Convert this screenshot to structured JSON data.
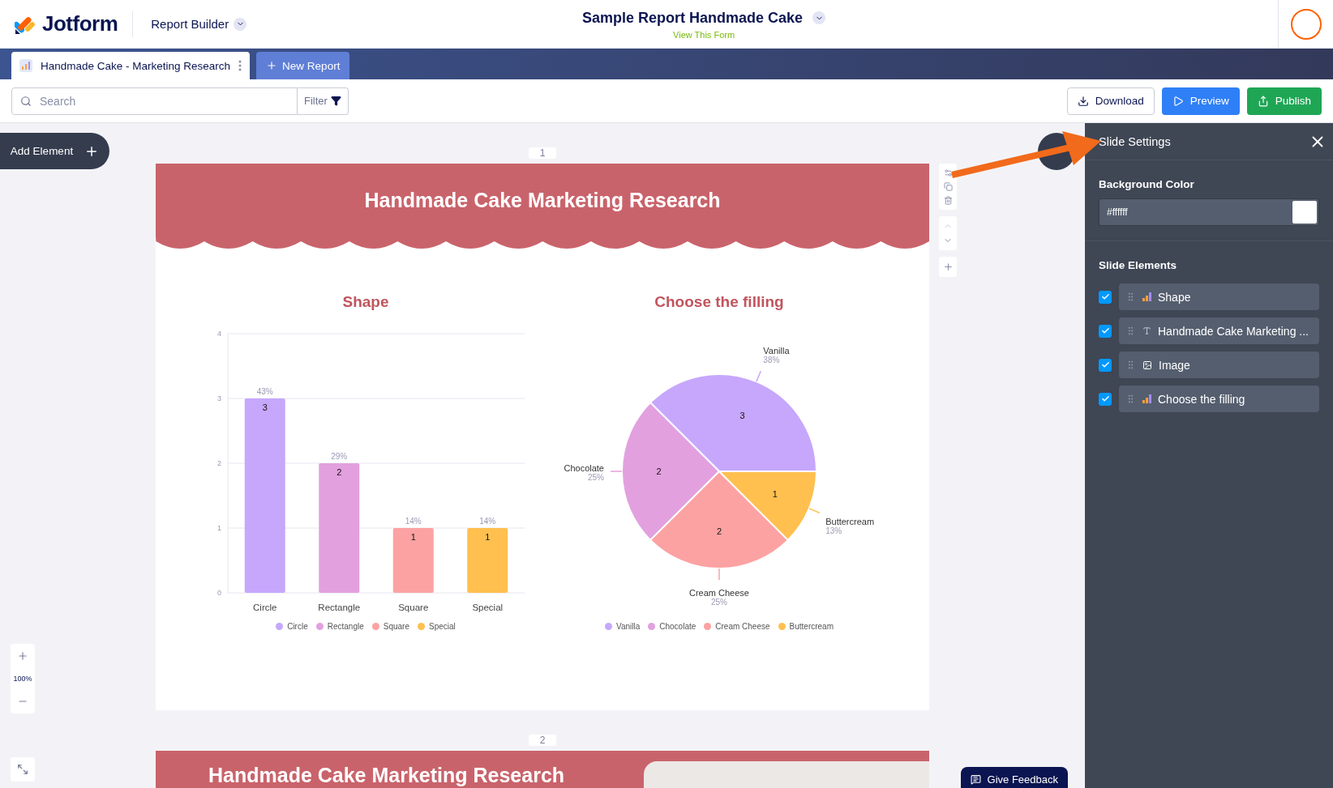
{
  "header": {
    "logo": "Jotform",
    "app_menu": "Report Builder",
    "form_title": "Sample Report Handmade Cake",
    "form_link": "View This Form"
  },
  "tabs": [
    {
      "label": "Handmade Cake - Marketing Research",
      "selected": true
    }
  ],
  "new_report": "New Report",
  "toolbar": {
    "search": {
      "placeholder": "Search"
    },
    "filter": "Filter",
    "buttons": [
      {
        "label": "Download",
        "kind": "outline"
      },
      {
        "label": "Preview",
        "kind": "blue"
      },
      {
        "label": "Publish",
        "kind": "green"
      }
    ]
  },
  "canvas": {
    "add_element": "Add Element",
    "zoom": "100%",
    "feedback": "Give Feedback",
    "slides": [
      {
        "number": "1",
        "title": "Handmade Cake Marketing Research",
        "charts": [
          {
            "title": "Shape",
            "legend": [
              {
                "label": "Circle",
                "color": "#c6a7fc"
              },
              {
                "label": "Rectangle",
                "color": "#e2a0df"
              },
              {
                "label": "Square",
                "color": "#fca2a2"
              },
              {
                "label": "Special",
                "color": "#ffc04f"
              }
            ],
            "chart_data": {
              "type": "bar",
              "categories": [
                "Circle",
                "Rectangle",
                "Square",
                "Special"
              ],
              "series": [
                {
                  "values": [
                    3,
                    2,
                    1,
                    1
                  ]
                }
              ],
              "grid": true,
              "ylim": [
                0,
                4
              ],
              "yticks": [
                0,
                1,
                2,
                3,
                4
              ],
              "data_labels": true,
              "value_labels": [
                "43%",
                "29%",
                "14%",
                "14%"
              ]
            }
          },
          {
            "title": "Choose the filling",
            "legend": [
              {
                "label": "Vanilla",
                "color": "#c6a7fc"
              },
              {
                "label": "Chocolate",
                "color": "#e2a0df"
              },
              {
                "label": "Cream Cheese",
                "color": "#fca2a2"
              },
              {
                "label": "Buttercream",
                "color": "#ffc04f"
              }
            ],
            "chart_data": {
              "type": "pie",
              "categories": [
                "Vanilla",
                "Chocolate",
                "Cream Cheese",
                "Buttercream"
              ],
              "series": [
                {
                  "values": [
                    3,
                    2,
                    2,
                    1
                  ]
                }
              ],
              "data_labels": true,
              "value_labels": [
                "38%",
                "25%",
                "25%",
                "13%"
              ]
            }
          }
        ]
      },
      {
        "number": "2",
        "title": "Handmade Cake Marketing Research"
      }
    ]
  },
  "panel": {
    "title": "Slide Settings",
    "background_label": "Background Color",
    "background_value": "#ffffff",
    "elements_label": "Slide Elements",
    "elements": [
      {
        "label": "Shape",
        "kind": "chart",
        "checked": true
      },
      {
        "label": "Handmade Cake Marketing ...",
        "kind": "text",
        "checked": true
      },
      {
        "label": "Image",
        "kind": "image",
        "checked": true
      },
      {
        "label": "Choose the filling",
        "kind": "chart",
        "checked": true
      }
    ]
  }
}
